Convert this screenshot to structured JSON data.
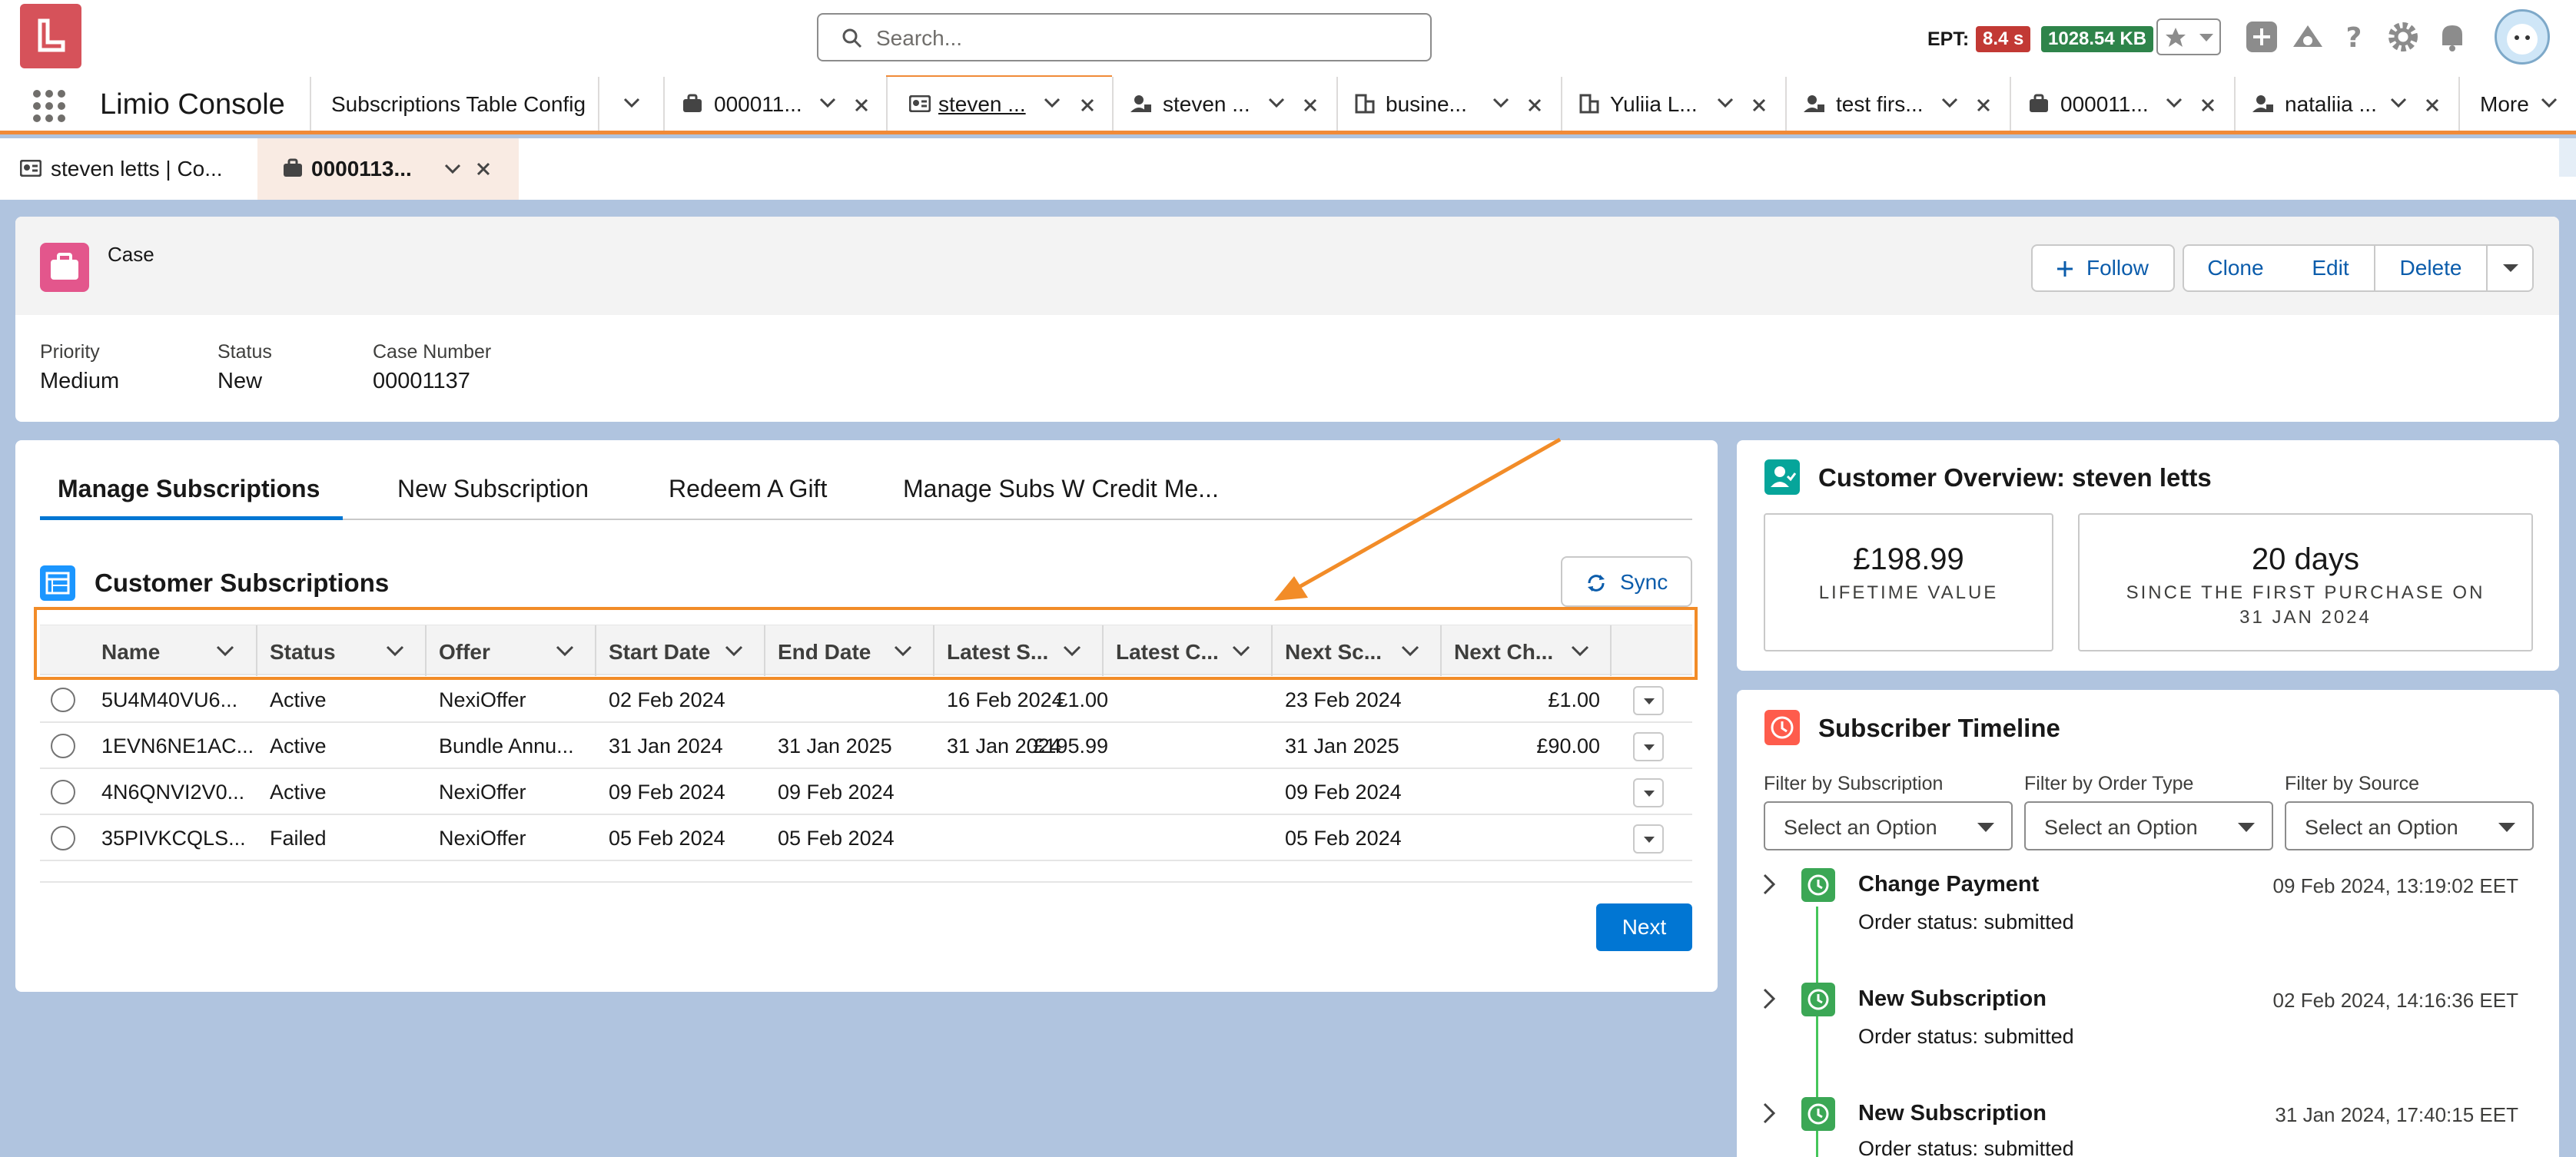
{
  "global_header": {
    "search_placeholder": "Search...",
    "ept_label": "EPT:",
    "ept_time": "8.4 s",
    "ept_size": "1028.54 KB"
  },
  "nav": {
    "app_name": "Limio Console",
    "tabs": [
      {
        "label": "Subscriptions Table Config",
        "icon": "none"
      },
      {
        "label": "000011...",
        "icon": "briefcase-icon"
      },
      {
        "label": "steven ...",
        "icon": "contact-card-icon",
        "active": true
      },
      {
        "label": "steven ...",
        "icon": "person-account-icon"
      },
      {
        "label": "busine...",
        "icon": "building-icon"
      },
      {
        "label": "Yuliia L...",
        "icon": "building-icon"
      },
      {
        "label": "test firs...",
        "icon": "person-account-icon"
      },
      {
        "label": "000011...",
        "icon": "briefcase-icon"
      },
      {
        "label": "nataliia ...",
        "icon": "person-account-icon"
      }
    ],
    "more_label": "More"
  },
  "subtabs": [
    {
      "label": "steven letts | Co..."
    },
    {
      "label": "0000113..."
    }
  ],
  "record": {
    "object_label": "Case",
    "buttons": {
      "follow": "Follow",
      "clone": "Clone",
      "edit": "Edit",
      "delete": "Delete"
    },
    "fields": [
      {
        "label": "Priority",
        "value": "Medium"
      },
      {
        "label": "Status",
        "value": "New"
      },
      {
        "label": "Case Number",
        "value": "00001137"
      }
    ]
  },
  "main": {
    "tabs": [
      {
        "label": "Manage Subscriptions",
        "active": true
      },
      {
        "label": "New Subscription"
      },
      {
        "label": "Redeem A Gift"
      },
      {
        "label": "Manage Subs W Credit Me..."
      }
    ],
    "section_title": "Customer Subscriptions",
    "sync_label": "Sync",
    "columns": [
      "Name",
      "Status",
      "Offer",
      "Start Date",
      "End Date",
      "Latest S...",
      "Latest C...",
      "Next Sc...",
      "Next Ch..."
    ],
    "rows": [
      [
        "5U4M40VU6...",
        "Active",
        "NexiOffer",
        "02 Feb 2024",
        "",
        "16 Feb 2024",
        "£1.00",
        "23 Feb 2024",
        "£1.00"
      ],
      [
        "1EVN6NE1AC...",
        "Active",
        "Bundle Annu...",
        "31 Jan 2024",
        "31 Jan 2025",
        "31 Jan 2024",
        "£195.99",
        "31 Jan 2025",
        "£90.00"
      ],
      [
        "4N6QNVI2V0...",
        "Active",
        "NexiOffer",
        "09 Feb 2024",
        "09 Feb 2024",
        "",
        "",
        "09 Feb 2024",
        ""
      ],
      [
        "35PIVKCQLS...",
        "Failed",
        "NexiOffer",
        "05 Feb 2024",
        "05 Feb 2024",
        "",
        "",
        "05 Feb 2024",
        ""
      ]
    ],
    "next_label": "Next"
  },
  "overview": {
    "title": "Customer Overview: steven letts",
    "lifetime_value": "£198.99",
    "lifetime_label": "LIFETIME VALUE",
    "days_value": "20 days",
    "days_label_1": "SINCE THE FIRST PURCHASE ON",
    "days_label_2": "31 JAN 2024"
  },
  "timeline": {
    "title": "Subscriber Timeline",
    "filters": [
      {
        "label": "Filter by Subscription",
        "value": "Select an Option"
      },
      {
        "label": "Filter by Order Type",
        "value": "Select an Option"
      },
      {
        "label": "Filter by Source",
        "value": "Select an Option"
      }
    ],
    "events": [
      {
        "title": "Change Payment",
        "date": "09 Feb 2024, 13:19:02 EET",
        "status": "Order status: submitted"
      },
      {
        "title": "New Subscription",
        "date": "02 Feb 2024, 14:16:36 EET",
        "status": "Order status: submitted"
      },
      {
        "title": "New Subscription",
        "date": "31 Jan 2024, 17:40:15 EET",
        "status": "Order status: submitted"
      }
    ]
  },
  "colors": {
    "brand": "#0176d3",
    "nav_accent": "#f08a38",
    "highlight": "#f28c28",
    "case_icon": "#e3568c"
  }
}
